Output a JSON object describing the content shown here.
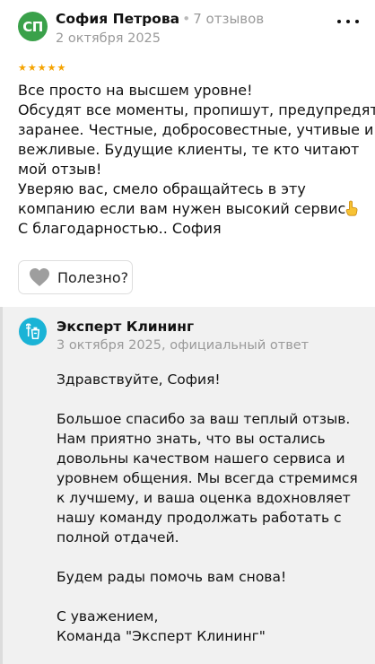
{
  "review": {
    "avatar_initials": "СП",
    "author_name": "София Петрова",
    "separator": "•",
    "reviews_count": "7 отзывов",
    "date": "2 октября 2025",
    "rating": 5,
    "star_glyph": "★",
    "text_lines": [
      "Все просто на высшем уровне!",
      "Обсудят все моменты, пропишут, предупредят",
      "заранее. Честные, добросовестные, учтивые и",
      "вежливые. Будущие клиенты, те кто читают",
      "мой отзыв!",
      "Уверяю вас, смело обращайтесь в эту",
      "компанию если вам нужен высокий сервис",
      "С благодарностью.. София"
    ],
    "helpful_label": "Полезно?"
  },
  "answer": {
    "company_name": "Эксперт Клининг",
    "meta": "3 октября 2025, официальный ответ",
    "text_lines": [
      "Здравствуйте, София!",
      "",
      "Большое спасибо за ваш теплый отзыв.",
      "Нам приятно знать, что вы остались",
      "довольны качеством нашего сервиса и",
      "уровнем общения. Мы всегда стремимся",
      "к лучшему, и ваша оценка вдохновляет",
      "нашу команду продолжать работать с",
      "полной отдачей.",
      "",
      "Будем рады помочь вам снова!",
      "",
      "С уважением,",
      "Команда \"Эксперт Клининг\""
    ]
  },
  "colors": {
    "avatar_bg": "#3aa14a",
    "star": "#f5a300",
    "logo_bg": "#1ab3d6",
    "muted_text": "#9a9a9a",
    "answer_bg": "#f1f1f1"
  },
  "icons": {
    "more": "more-horizontal-icon",
    "helpful": "heart-icon",
    "emoji": "pointing-finger-emoji",
    "company_logo": "cleaning-company-logo"
  }
}
